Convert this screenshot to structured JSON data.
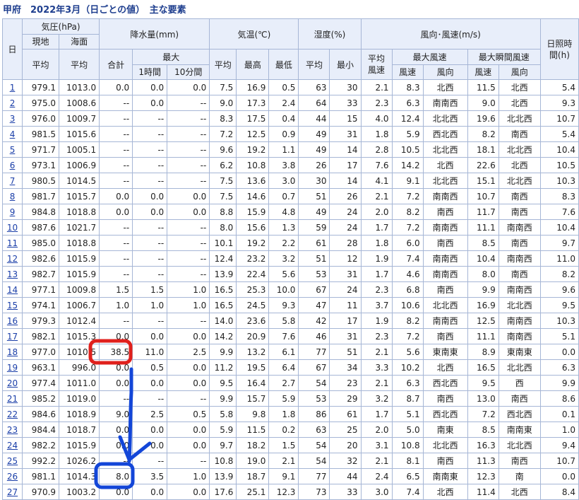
{
  "page_title": "甲府　2022年3月（日ごとの値）　主な要素",
  "header": {
    "day": "日",
    "pressure": "気圧(hPa)",
    "station": "現地",
    "sea": "海面",
    "avg": "平均",
    "precip": "降水量(mm)",
    "total": "合計",
    "max": "最大",
    "one_hour": "1時間",
    "ten_min": "10分間",
    "temp": "気温(℃)",
    "high": "最高",
    "low": "最低",
    "humidity": "湿度(%)",
    "min": "最小",
    "wind": "風向･風速(m/s)",
    "avg_wind_1": "平均",
    "avg_wind_2": "風速",
    "max_wind": "最大風速",
    "max_gust": "最大瞬間風速",
    "speed": "風速",
    "direction": "風向",
    "sun": "日照時間(h)"
  },
  "rows": [
    [
      "1",
      "979.1",
      "1013.0",
      "0.0",
      "0.0",
      "0.0",
      "7.5",
      "16.9",
      "0.5",
      "63",
      "30",
      "2.1",
      "8.3",
      "北西",
      "11.5",
      "北西",
      "5.4"
    ],
    [
      "2",
      "975.0",
      "1008.6",
      "--",
      "0.0",
      "--",
      "9.0",
      "17.3",
      "2.4",
      "64",
      "33",
      "2.3",
      "6.3",
      "南南西",
      "9.0",
      "北西",
      "9.3"
    ],
    [
      "3",
      "976.0",
      "1009.7",
      "--",
      "--",
      "--",
      "8.3",
      "17.5",
      "0.4",
      "44",
      "15",
      "4.0",
      "12.4",
      "北北西",
      "19.6",
      "北北西",
      "10.7"
    ],
    [
      "4",
      "981.5",
      "1015.6",
      "--",
      "--",
      "--",
      "7.2",
      "12.5",
      "0.9",
      "49",
      "31",
      "1.8",
      "5.9",
      "西北西",
      "8.2",
      "南西",
      "5.4"
    ],
    [
      "5",
      "971.7",
      "1005.1",
      "--",
      "--",
      "--",
      "9.6",
      "19.2",
      "1.1",
      "49",
      "14",
      "2.8",
      "10.5",
      "北北西",
      "18.1",
      "北北西",
      "10.4"
    ],
    [
      "6",
      "973.1",
      "1006.9",
      "--",
      "--",
      "--",
      "6.2",
      "10.8",
      "3.8",
      "26",
      "17",
      "7.6",
      "14.2",
      "北西",
      "22.6",
      "北西",
      "10.5"
    ],
    [
      "7",
      "980.5",
      "1014.5",
      "--",
      "--",
      "--",
      "7.5",
      "13.6",
      "3.0",
      "30",
      "14",
      "4.1",
      "9.1",
      "北北西",
      "15.1",
      "北北西",
      "10.3"
    ],
    [
      "8",
      "981.7",
      "1015.7",
      "0.0",
      "0.0",
      "0.0",
      "7.5",
      "14.6",
      "0.7",
      "51",
      "26",
      "2.1",
      "7.2",
      "南南西",
      "10.7",
      "南西",
      "8.3"
    ],
    [
      "9",
      "984.8",
      "1018.8",
      "0.0",
      "0.0",
      "0.0",
      "8.8",
      "15.9",
      "4.8",
      "49",
      "24",
      "2.0",
      "8.2",
      "南西",
      "11.7",
      "南西",
      "7.6"
    ],
    [
      "10",
      "987.6",
      "1021.7",
      "--",
      "--",
      "--",
      "8.0",
      "15.6",
      "1.3",
      "59",
      "24",
      "1.7",
      "7.2",
      "南南西",
      "11.1",
      "南南西",
      "10.4"
    ],
    [
      "11",
      "985.0",
      "1018.8",
      "--",
      "--",
      "--",
      "10.1",
      "19.2",
      "2.2",
      "61",
      "28",
      "1.8",
      "6.0",
      "南西",
      "8.5",
      "南西",
      "9.7"
    ],
    [
      "12",
      "982.6",
      "1015.9",
      "--",
      "--",
      "--",
      "12.4",
      "23.2",
      "3.2",
      "51",
      "12",
      "1.9",
      "7.4",
      "南南西",
      "10.4",
      "南南西",
      "11.0"
    ],
    [
      "13",
      "982.7",
      "1015.9",
      "--",
      "--",
      "--",
      "13.9",
      "22.4",
      "5.6",
      "53",
      "31",
      "1.7",
      "4.6",
      "南南西",
      "8.0",
      "南西",
      "8.2"
    ],
    [
      "14",
      "977.1",
      "1009.8",
      "1.5",
      "1.5",
      "1.0",
      "16.5",
      "25.3",
      "10.0",
      "67",
      "24",
      "2.3",
      "6.8",
      "南西",
      "9.9",
      "南南西",
      "9.6"
    ],
    [
      "15",
      "974.1",
      "1006.7",
      "1.0",
      "1.0",
      "1.0",
      "16.5",
      "24.5",
      "9.3",
      "47",
      "11",
      "3.7",
      "10.6",
      "北北西",
      "16.9",
      "北北西",
      "9.5"
    ],
    [
      "16",
      "979.3",
      "1012.4",
      "--",
      "--",
      "--",
      "14.0",
      "23.6",
      "5.8",
      "42",
      "17",
      "1.9",
      "8.2",
      "南南西",
      "12.5",
      "南南西",
      "10.3"
    ],
    [
      "17",
      "982.1",
      "1015.3",
      "0.0",
      "0.0",
      "0.0",
      "14.2",
      "20.9",
      "7.6",
      "46",
      "31",
      "2.3",
      "7.2",
      "南西",
      "11.1",
      "南南西",
      "5.1"
    ],
    [
      "18",
      "977.0",
      "1010.5",
      "38.5",
      "11.0",
      "2.5",
      "9.9",
      "13.2",
      "6.1",
      "77",
      "51",
      "2.1",
      "5.6",
      "東南東",
      "8.9",
      "東南東",
      "0.0"
    ],
    [
      "19",
      "963.1",
      "996.0",
      "0.0",
      "0.5",
      "0.0",
      "11.2",
      "19.5",
      "6.4",
      "67",
      "34",
      "3.3",
      "10.2",
      "北西",
      "16.5",
      "北北西",
      "6.3"
    ],
    [
      "20",
      "977.4",
      "1011.0",
      "0.0",
      "0.0",
      "0.0",
      "9.5",
      "16.4",
      "2.7",
      "54",
      "23",
      "2.1",
      "6.3",
      "西北西",
      "9.5",
      "西",
      "9.9"
    ],
    [
      "21",
      "985.2",
      "1019.0",
      "--",
      "--",
      "--",
      "9.9",
      "15.7",
      "5.9",
      "53",
      "29",
      "3.2",
      "8.7",
      "南西",
      "13.0",
      "南西",
      "8.6"
    ],
    [
      "22",
      "984.6",
      "1018.9",
      "9.0",
      "2.5",
      "0.5",
      "5.8",
      "9.8",
      "1.8",
      "86",
      "61",
      "1.7",
      "5.1",
      "西北西",
      "7.2",
      "西北西",
      "0.1"
    ],
    [
      "23",
      "984.4",
      "1018.7",
      "0.0",
      "0.0",
      "0.0",
      "5.9",
      "11.5",
      "0.2",
      "63",
      "25",
      "2.0",
      "5.0",
      "南東",
      "8.5",
      "南南東",
      "1.0"
    ],
    [
      "24",
      "982.2",
      "1015.9",
      "0.0",
      "0.0",
      "0.0",
      "9.7",
      "18.2",
      "1.5",
      "54",
      "20",
      "3.1",
      "10.8",
      "北北西",
      "16.3",
      "北北西",
      "9.4"
    ],
    [
      "25",
      "992.2",
      "1026.2",
      "--",
      "--",
      "--",
      "10.8",
      "19.0",
      "2.1",
      "54",
      "32",
      "2.1",
      "8.1",
      "南西",
      "11.3",
      "南西",
      "10.7"
    ],
    [
      "26",
      "981.1",
      "1014.3",
      "8.0",
      "3.5",
      "1.0",
      "13.9",
      "18.7",
      "9.1",
      "77",
      "44",
      "2.4",
      "6.5",
      "南南東",
      "12.3",
      "南",
      "0.0"
    ],
    [
      "27",
      "970.9",
      "1003.2",
      "0.0",
      "0.0",
      "0.0",
      "17.6",
      "25.1",
      "12.3",
      "73",
      "33",
      "3.0",
      "7.4",
      "北西",
      "11.4",
      "北西",
      "8.4"
    ]
  ],
  "annotation_colors": {
    "red_box": "#e0201c",
    "blue_marks": "#1346d8"
  }
}
